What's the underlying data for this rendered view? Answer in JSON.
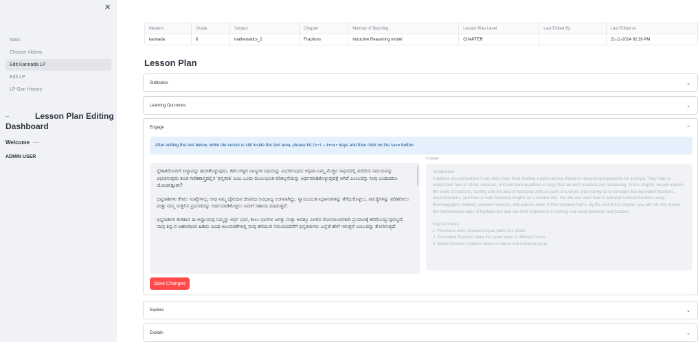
{
  "sidebar": {
    "close_icon": "close-icon",
    "items": [
      {
        "label": "Main",
        "active": false
      },
      {
        "label": "Choose Videos",
        "active": false
      },
      {
        "label": "Edit Kannada LP",
        "active": true
      },
      {
        "label": "Edit LP",
        "active": false
      },
      {
        "label": "LP Gen History",
        "active": false
      }
    ],
    "dashboard_title": "Lesson Plan Editing Dashboard",
    "welcome": "Welcome",
    "user": "ADMIN USER"
  },
  "table": {
    "headers": [
      "Medium",
      "Grade",
      "Subject",
      "Chapter",
      "Method of Teaching",
      "Lesson Plan Level",
      "Last Edited By",
      "Last Edited At"
    ],
    "row": [
      "kannada",
      "6",
      "mathematics_2",
      "Fractions",
      "Inductive Reasoning model",
      "CHAPTER",
      "",
      "21-11-2024 02:28 PM"
    ]
  },
  "page_title": "Lesson Plan",
  "sections": {
    "subtopics": "Subtopics",
    "learning_outcomes": "Learning Outcomes",
    "engage": "Engage",
    "explore": "Explore",
    "explain": "Explain"
  },
  "info": {
    "before": "After editing the text below, while the cursor is still inside the text area, please hit",
    "key1": "Ctrl",
    "plus": "+",
    "key2": "Enter",
    "middle": "keys and then click on the",
    "key3": "Save",
    "after": "button"
  },
  "editor": {
    "p1": "ಸ್ನೇಹಿತರೊಂದಿಗೆ ಪಿಜ್ಜಾವನ್ನು ಹಂಚಿಕೊಳ್ಳುವುದು, ಕಡಲುಗಳ್ಳರ ನಾಣ್ಯಗಳ ನಿಧಿಯನ್ನು ವಿಭಜಿಸುವುದು ಅಥವಾ ನಿಮ್ಮ ಮೆಚ್ಚಿನ ಸಾಧನದಲ್ಲಿ ಪರದೆಯ ಸಮಯವನ್ನು ವಿಭಜಿಸುವುದು ಕೂಡ ಗಣಿತಶಾಸ್ತ್ರದಲ್ಲಿನ 'ಭಿನ್ನರಾಶಿ' ಎಂಬ ಒಂದು ಮೂಲಭೂತ ಪರಿಕಲ್ಪನೆಯನ್ನು ಅರ್ಥಮಾಡಿಕೊಳ್ಳುವುದಕ್ಕೆ ಆಗಿದೆ ಎಂಬುದನ್ನು ನೀವು ಎಂದಾದರೂ ಯೋಚಿಸಿದ್ದೀರಾ?",
    "p2": "ಭಿನ್ನರಾಶಿಗಳು ಕೇವಲ ಸಂಖ್ಯೆಗಳಲ್ಲ; ಅವು ನಮ್ಮ ದೈನಂದಿನ ಜೀವನದ ಅವಿಭಾಜ್ಯ ಅಂಗವಾಗಿದ್ದು, ನ್ಯಾಯಯುತ ನಿರ್ಧಾರಗಳನ್ನು ತೆಗೆದುಕೊಳ್ಳಲು, ಸಮಸ್ಯೆಗಳನ್ನು ಪರಿಹರಿಸಲು ಮತ್ತು ನಮ್ಮ ಸುತ್ತಲಿನ ಪ್ರಪಂಚವನ್ನು ಅರ್ಥಮಾಡಿಕೊಳ್ಳಲು ನಮಗೆ ಸಹಾಯ ಮಾಡುತ್ತವೆ.",
    "p3": "ಭಿನ್ನರಾಶಿಗಳ ಕುರಿತಾದ ಈ ಅಧ್ಯಾಯವು ನಿಮ್ಮನ್ನು ಅರ್ಧ ಭಾಗ, ಕಾಲು ಭಾಗಗಳ ಜಗತ್ತು ಮತ್ತು ಅದಕ್ಕೂ ಮೀರಿದ ರೋಮಾಂಚನಕಾರಿ ಪ್ರಯಾಣಕ್ಕೆ ಕರೆದೊಯ್ಯುವುದಲ್ಲದೆ, ನಾವು ತಿನ್ನುವ ಆಹಾರದಿಂದ ಹಿಡಿದು ವಿವಿಧ ಆಟುವಟಿಕೆಗಳಲ್ಲಿ ನಾವು ಕಳೆಯುವ ಸಮಯದವರೆಗೆ ಭಿನ್ನರಾಶಿಗಳು ಎಲ್ಲೆಡೆ ಹೇಗೆ ಇರುತ್ತವೆ ಎಂಬುದನ್ನು ತೋರಿಸುತ್ತದೆ."
  },
  "preview": {
    "label": "Engage",
    "heading": "Introduction:",
    "p1": "Fractions are everywhere in our daily lives, from dividing a pizza among friends to measuring ingredients for a recipe. They help us understand how to share, measure, and compare quantities in ways that are both practical and fascinating. In this chapter, we will explore the world of fractions, starting with the idea of fractional units as parts of a whole and moving on to concepts like equivalent fractions, mixed fractions, and how to mark fractional lengths on a number line. We will also learn how to add and subtract fractions using Brahmagupta's method, compare fractions, and express them in their simplest forms. By the end of this chapter, you will not only master the mathematical rules of fractions but also see their importance in solving real-world problems and puzzles.",
    "kc_heading": "Key Concepts:",
    "kc1": "1. Fractional units represent equal parts of a whole.",
    "kc2": "2. Equivalent fractions show the same value in different forms.",
    "kc3": "3. Mixed fractions combine whole numbers and fractional parts."
  },
  "save_button": "Save Changes",
  "icons": {
    "collapsed": "chevron-down-icon",
    "expanded": "chevron-up-icon"
  }
}
